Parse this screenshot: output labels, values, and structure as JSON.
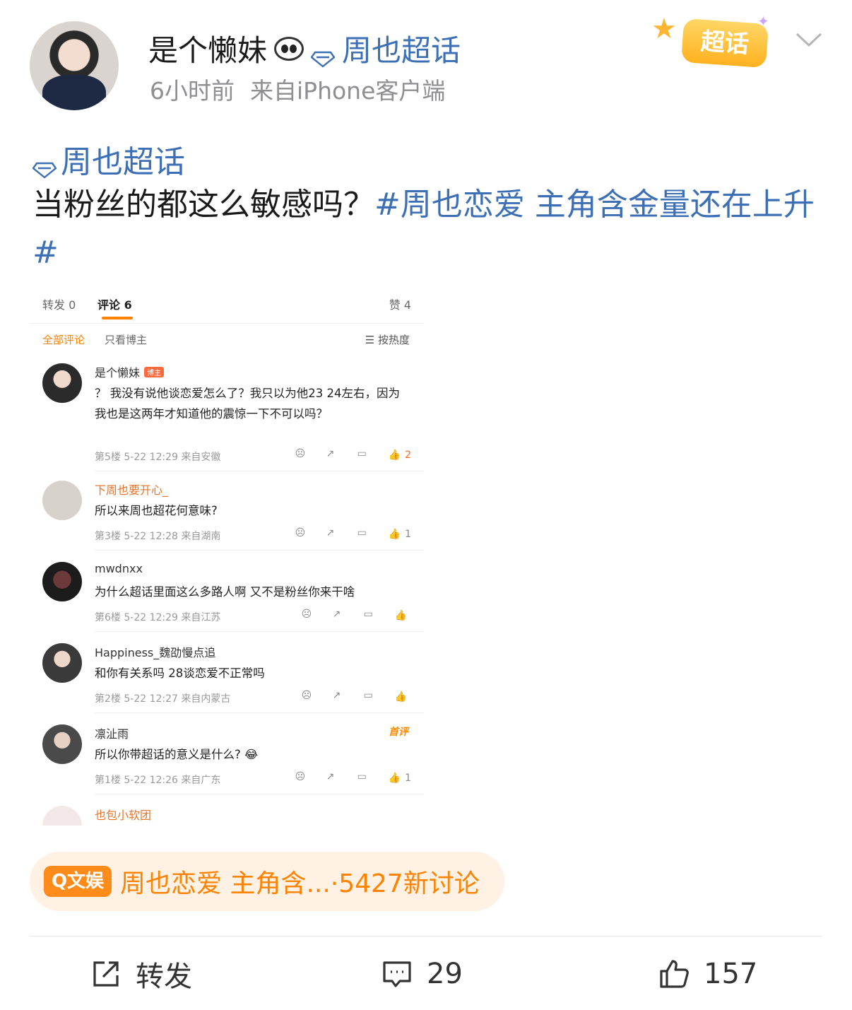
{
  "post": {
    "username": "是个懒妹",
    "topic_badge": "周也超话",
    "time": "6小时前",
    "source": "来自iPhone客户端",
    "chaohua_label": "超话",
    "topic_line": "周也超话",
    "text_plain": "当粉丝的都这么敏感吗？",
    "text_tag": "#周也恋爱 主角含金量还在上升#"
  },
  "screenshot": {
    "tabs": [
      "转发 0",
      "评论 6",
      "赞 4"
    ],
    "filter": {
      "all": "全部评论",
      "owner": "只看博主",
      "sort": "按热度"
    },
    "comments": [
      {
        "name": "是个懒妹",
        "badge": "博主",
        "text": "？ 我没有说他谈恋爱怎么了？我只以为他23 24左右，因为我也是这两年才知道他的震惊一下不可以吗？",
        "meta": "第5楼 5-22 12:29 来自安徽",
        "likes": "2"
      },
      {
        "name": "下周也要开心_",
        "text": "所以来周也超花何意味?",
        "meta": "第3楼 5-22 12:28 来自湖南",
        "likes": "1"
      },
      {
        "name": "mwdnxx",
        "text": "为什么超话里面这么多路人啊 又不是粉丝你来干啥",
        "meta": "第6楼 5-22 12:29 来自江苏",
        "likes": ""
      },
      {
        "name": "Happiness_魏劭慢点追",
        "text": "和你有关系吗 28谈恋爱不正常吗",
        "meta": "第2楼 5-22 12:27 来自内蒙古",
        "likes": ""
      },
      {
        "name": "凛沚雨",
        "text": "所以你带超话的意义是什么? 😂",
        "meta": "第1楼 5-22 12:26 来自广东",
        "likes": "1",
        "tag": "首评"
      },
      {
        "name": "也包小软团"
      }
    ]
  },
  "hot_topic": {
    "tag": "Q文娱",
    "label": "周也恋爱 主角含...·5427新讨论"
  },
  "action_bar": {
    "repost": "转发",
    "comments": "29",
    "likes": "157"
  },
  "colors": {
    "link": "#3d6fb5",
    "accent": "#ff8200",
    "pill_bg": "#fff1e3"
  }
}
